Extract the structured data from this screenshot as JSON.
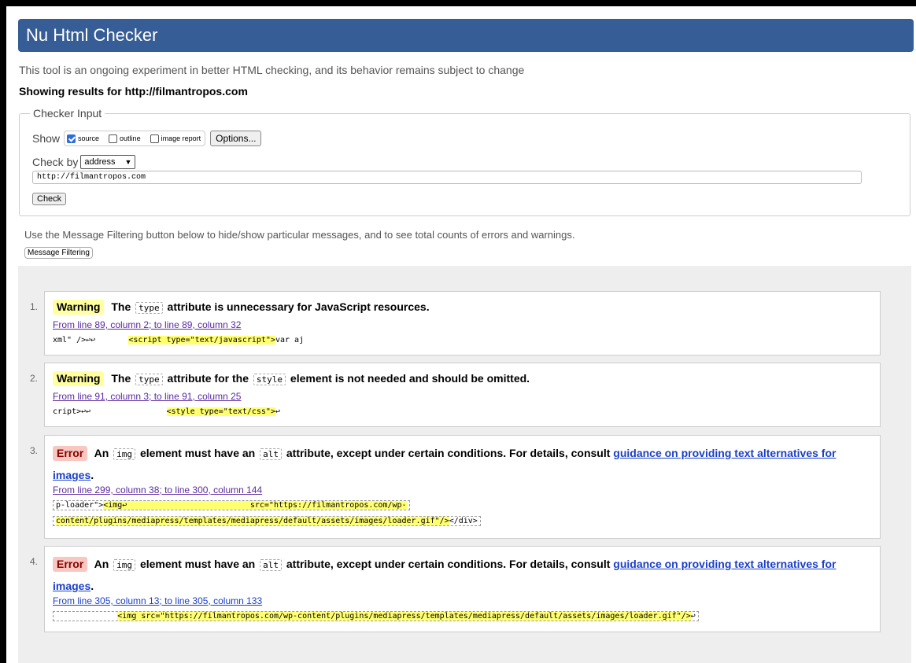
{
  "header": {
    "title": "Nu Html Checker"
  },
  "intro": "This tool is an ongoing experiment in better HTML checking, and its behavior remains subject to change",
  "showing": "Showing results for http://filmantropos.com",
  "checker_input": {
    "legend": "Checker Input",
    "show_label": "Show",
    "options": [
      {
        "label": "source",
        "checked": true
      },
      {
        "label": "outline",
        "checked": false
      },
      {
        "label": "image report",
        "checked": false
      }
    ],
    "options_button": "Options...",
    "check_by_label": "Check by",
    "check_by_value": "address",
    "address_value": "http://filmantropos.com",
    "check_button": "Check"
  },
  "filter": {
    "hint": "Use the Message Filtering button below to hide/show particular messages, and to see total counts of errors and warnings.",
    "button": "Message Filtering"
  },
  "messages": [
    {
      "num": "1.",
      "type": "Warning",
      "parts": [
        "The",
        "type",
        "attribute is unnecessary for JavaScript resources."
      ],
      "location": "From line 89, column 2; to line 89, column 32",
      "extract_pre": "xml\" />↩↩       ",
      "extract_hl": "<script type=\"text/javascript\">",
      "extract_post": "var aj"
    },
    {
      "num": "2.",
      "type": "Warning",
      "parts": [
        "The",
        "type",
        "attribute for the",
        "style",
        "element is not needed and should be omitted."
      ],
      "location": "From line 91, column 3; to line 91, column 25",
      "extract_pre": "cript>↩↩                ",
      "extract_hl": "<style type=\"text/css\">",
      "extract_post": "↩"
    },
    {
      "num": "3.",
      "type": "Error",
      "parts": [
        "An",
        "img",
        "element must have an",
        "alt",
        "attribute, except under certain conditions. For details, consult",
        "guidance on providing text alternatives for",
        "images",
        "."
      ],
      "location": "From line 299, column 38; to line 300, column 144",
      "extract_line1_pre": "p-loader\">",
      "extract_line1_hl": "<img↩                          src=\"https://filmantropos.com/wp-",
      "extract_line2_hl": "content/plugins/mediapress/templates/mediapress/default/assets/images/loader.gif\"/>",
      "extract_line2_post": "</div>"
    },
    {
      "num": "4.",
      "type": "Error",
      "parts": [
        "An",
        "img",
        "element must have an",
        "alt",
        "attribute, except under certain conditions. For details, consult",
        "guidance on providing text alternatives for",
        "images",
        "."
      ],
      "location": "From line 305, column 13; to line 305, column 133",
      "extract_pre": "             ",
      "extract_hl": "<img src=\"https://filmantropos.com/wp-content/plugins/mediapress/templates/mediapress/default/assets/images/loader.gif\"/>",
      "extract_post": "↩"
    }
  ]
}
